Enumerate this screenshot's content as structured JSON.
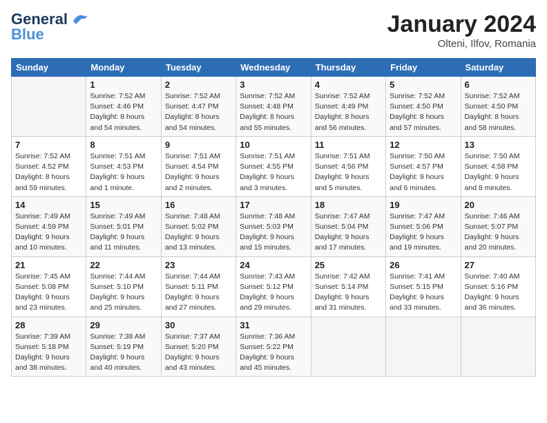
{
  "header": {
    "logo_general": "General",
    "logo_blue": "Blue",
    "month_year": "January 2024",
    "location": "Olteni, Ilfov, Romania"
  },
  "weekdays": [
    "Sunday",
    "Monday",
    "Tuesday",
    "Wednesday",
    "Thursday",
    "Friday",
    "Saturday"
  ],
  "weeks": [
    [
      {
        "day": "",
        "info": ""
      },
      {
        "day": "1",
        "info": "Sunrise: 7:52 AM\nSunset: 4:46 PM\nDaylight: 8 hours\nand 54 minutes."
      },
      {
        "day": "2",
        "info": "Sunrise: 7:52 AM\nSunset: 4:47 PM\nDaylight: 8 hours\nand 54 minutes."
      },
      {
        "day": "3",
        "info": "Sunrise: 7:52 AM\nSunset: 4:48 PM\nDaylight: 8 hours\nand 55 minutes."
      },
      {
        "day": "4",
        "info": "Sunrise: 7:52 AM\nSunset: 4:49 PM\nDaylight: 8 hours\nand 56 minutes."
      },
      {
        "day": "5",
        "info": "Sunrise: 7:52 AM\nSunset: 4:50 PM\nDaylight: 8 hours\nand 57 minutes."
      },
      {
        "day": "6",
        "info": "Sunrise: 7:52 AM\nSunset: 4:50 PM\nDaylight: 8 hours\nand 58 minutes."
      }
    ],
    [
      {
        "day": "7",
        "info": "Sunrise: 7:52 AM\nSunset: 4:52 PM\nDaylight: 8 hours\nand 59 minutes."
      },
      {
        "day": "8",
        "info": "Sunrise: 7:51 AM\nSunset: 4:53 PM\nDaylight: 9 hours\nand 1 minute."
      },
      {
        "day": "9",
        "info": "Sunrise: 7:51 AM\nSunset: 4:54 PM\nDaylight: 9 hours\nand 2 minutes."
      },
      {
        "day": "10",
        "info": "Sunrise: 7:51 AM\nSunset: 4:55 PM\nDaylight: 9 hours\nand 3 minutes."
      },
      {
        "day": "11",
        "info": "Sunrise: 7:51 AM\nSunset: 4:56 PM\nDaylight: 9 hours\nand 5 minutes."
      },
      {
        "day": "12",
        "info": "Sunrise: 7:50 AM\nSunset: 4:57 PM\nDaylight: 9 hours\nand 6 minutes."
      },
      {
        "day": "13",
        "info": "Sunrise: 7:50 AM\nSunset: 4:58 PM\nDaylight: 9 hours\nand 8 minutes."
      }
    ],
    [
      {
        "day": "14",
        "info": "Sunrise: 7:49 AM\nSunset: 4:59 PM\nDaylight: 9 hours\nand 10 minutes."
      },
      {
        "day": "15",
        "info": "Sunrise: 7:49 AM\nSunset: 5:01 PM\nDaylight: 9 hours\nand 11 minutes."
      },
      {
        "day": "16",
        "info": "Sunrise: 7:48 AM\nSunset: 5:02 PM\nDaylight: 9 hours\nand 13 minutes."
      },
      {
        "day": "17",
        "info": "Sunrise: 7:48 AM\nSunset: 5:03 PM\nDaylight: 9 hours\nand 15 minutes."
      },
      {
        "day": "18",
        "info": "Sunrise: 7:47 AM\nSunset: 5:04 PM\nDaylight: 9 hours\nand 17 minutes."
      },
      {
        "day": "19",
        "info": "Sunrise: 7:47 AM\nSunset: 5:06 PM\nDaylight: 9 hours\nand 19 minutes."
      },
      {
        "day": "20",
        "info": "Sunrise: 7:46 AM\nSunset: 5:07 PM\nDaylight: 9 hours\nand 20 minutes."
      }
    ],
    [
      {
        "day": "21",
        "info": "Sunrise: 7:45 AM\nSunset: 5:08 PM\nDaylight: 9 hours\nand 23 minutes."
      },
      {
        "day": "22",
        "info": "Sunrise: 7:44 AM\nSunset: 5:10 PM\nDaylight: 9 hours\nand 25 minutes."
      },
      {
        "day": "23",
        "info": "Sunrise: 7:44 AM\nSunset: 5:11 PM\nDaylight: 9 hours\nand 27 minutes."
      },
      {
        "day": "24",
        "info": "Sunrise: 7:43 AM\nSunset: 5:12 PM\nDaylight: 9 hours\nand 29 minutes."
      },
      {
        "day": "25",
        "info": "Sunrise: 7:42 AM\nSunset: 5:14 PM\nDaylight: 9 hours\nand 31 minutes."
      },
      {
        "day": "26",
        "info": "Sunrise: 7:41 AM\nSunset: 5:15 PM\nDaylight: 9 hours\nand 33 minutes."
      },
      {
        "day": "27",
        "info": "Sunrise: 7:40 AM\nSunset: 5:16 PM\nDaylight: 9 hours\nand 36 minutes."
      }
    ],
    [
      {
        "day": "28",
        "info": "Sunrise: 7:39 AM\nSunset: 5:18 PM\nDaylight: 9 hours\nand 38 minutes."
      },
      {
        "day": "29",
        "info": "Sunrise: 7:38 AM\nSunset: 5:19 PM\nDaylight: 9 hours\nand 40 minutes."
      },
      {
        "day": "30",
        "info": "Sunrise: 7:37 AM\nSunset: 5:20 PM\nDaylight: 9 hours\nand 43 minutes."
      },
      {
        "day": "31",
        "info": "Sunrise: 7:36 AM\nSunset: 5:22 PM\nDaylight: 9 hours\nand 45 minutes."
      },
      {
        "day": "",
        "info": ""
      },
      {
        "day": "",
        "info": ""
      },
      {
        "day": "",
        "info": ""
      }
    ]
  ]
}
